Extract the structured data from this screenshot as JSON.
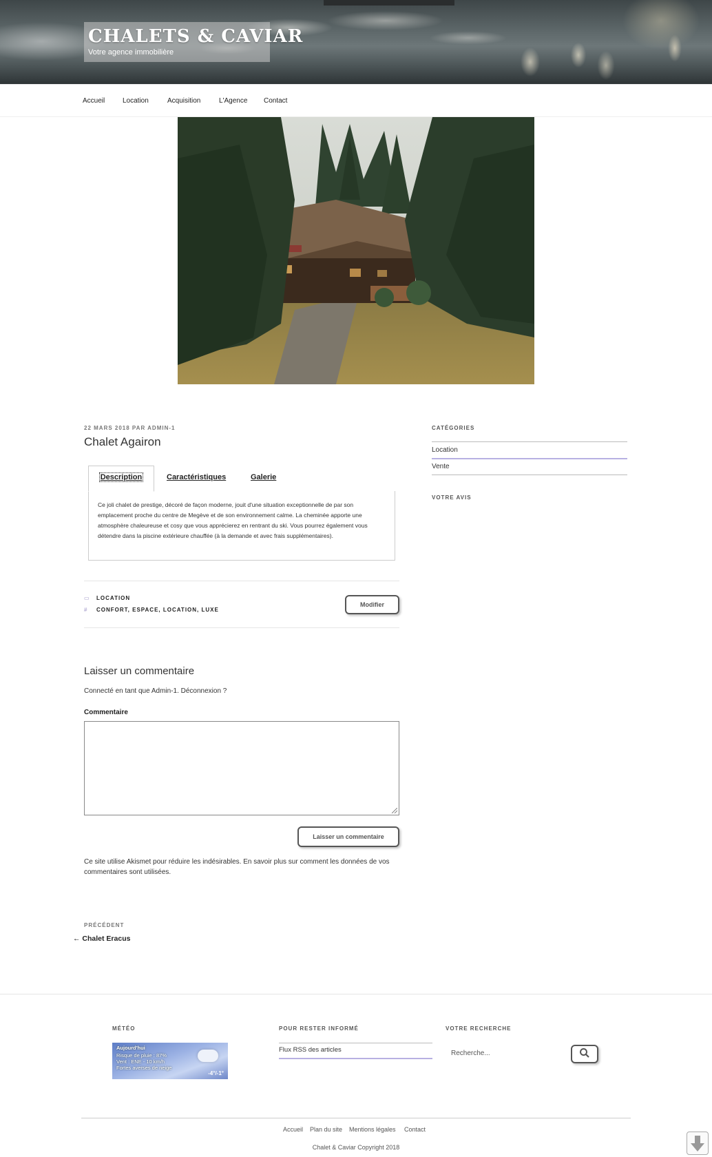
{
  "header": {
    "site_title": "CHALETS & CAVIAR",
    "site_description": "Votre agence immobilière"
  },
  "nav": {
    "items": [
      {
        "label": "Accueil"
      },
      {
        "label": "Location"
      },
      {
        "label": "Acquisition"
      },
      {
        "label": "L'Agence"
      },
      {
        "label": "Contact"
      }
    ]
  },
  "post": {
    "meta": "22 MARS 2018 PAR ADMIN-1",
    "title": "Chalet Agairon",
    "tabs": [
      {
        "label": "Description",
        "active": true
      },
      {
        "label": "Caractéristiques",
        "active": false
      },
      {
        "label": "Galerie",
        "active": false
      }
    ],
    "description": "Ce joli chalet de prestige, décoré de façon moderne, jouit d'une situation exceptionnelle de par son emplacement proche du centre de Megève et de son environnement calme. La cheminée apporte une atmosphère chaleureuse et cosy que vous apprécierez en rentrant du ski. Vous pourrez également vous détendre dans la piscine extérieure chauffée (à la demande et avec frais supplémentaires).",
    "category": "LOCATION",
    "tags": "CONFORT, ESPACE, LOCATION, LUXE",
    "edit_button": "Modifier"
  },
  "comments": {
    "title": "Laisser un commentaire",
    "logged_in": "Connecté en tant que Admin-1. Déconnexion ?",
    "comment_label": "Commentaire",
    "submit_button": "Laisser un commentaire",
    "akismet": "Ce site utilise Akismet pour réduire les indésirables. En savoir plus sur comment les données de vos commentaires sont utilisées."
  },
  "post_nav": {
    "prev_label": "PRÉCÉDENT",
    "prev_title": "Chalet Eracus"
  },
  "sidebar": {
    "categories_heading": "CATÉGORIES",
    "categories": [
      {
        "label": "Location"
      },
      {
        "label": "Vente"
      }
    ],
    "review_heading": "VOTRE AVIS"
  },
  "footer": {
    "meteo_heading": "MÉTÉO",
    "meteo": {
      "line1": "Aujourd'hui",
      "line2": "Risque de pluie : 87%",
      "line3": "Vent : ENE - 10 km/h",
      "line4": "Fortes averses de neige",
      "temp": "-4°/-1°"
    },
    "informed_heading": "POUR RESTER INFORMÉ",
    "rss_link": "Flux RSS des articles",
    "search_heading": "VOTRE RECHERCHE",
    "search_placeholder": "Recherche...",
    "links": [
      {
        "label": "Accueil"
      },
      {
        "label": "Plan du site"
      },
      {
        "label": "Mentions légales"
      },
      {
        "label": "Contact"
      }
    ],
    "copyright": "Chalet & Caviar Copyright 2018"
  },
  "colors": {
    "accent": "#b7b0e2",
    "text": "#333333"
  }
}
